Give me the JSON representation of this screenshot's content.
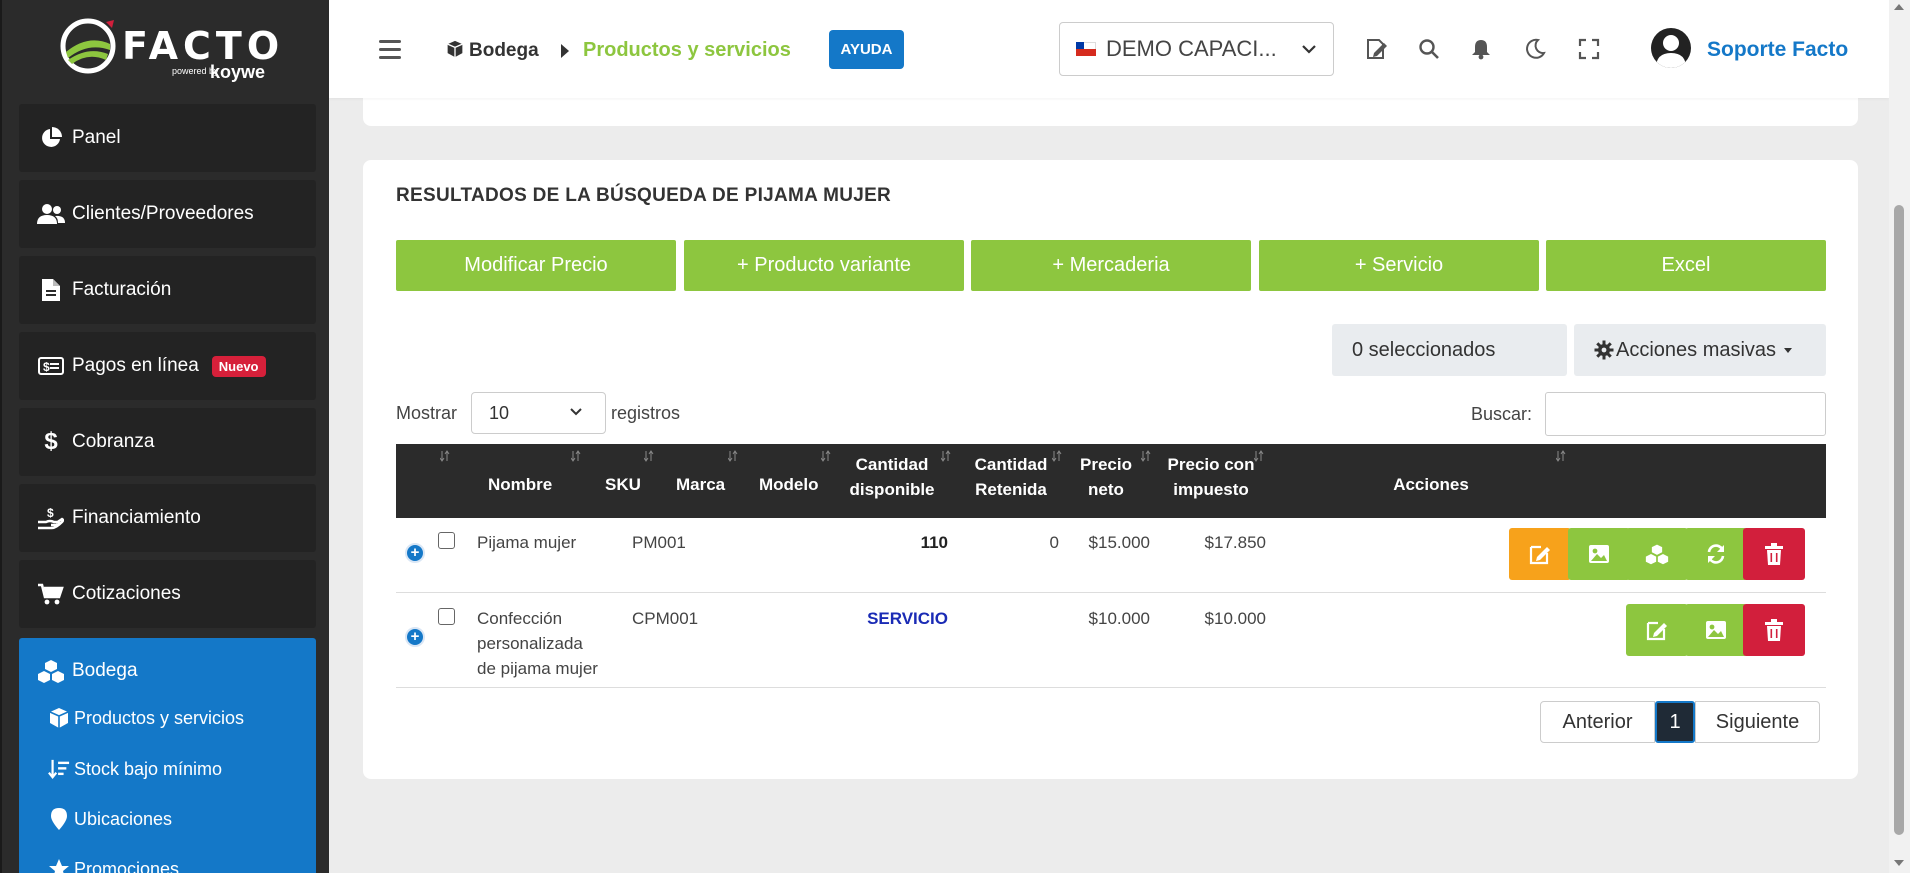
{
  "brand": {
    "logo_word": "FACTO",
    "logo_sub": "powered by",
    "logo_brand": "koywe",
    "green": "#8dc63f",
    "blue": "#1478c8",
    "red": "#d21f3c",
    "orange": "#f7a21b",
    "dark": "#2b2b2b"
  },
  "sidebar": {
    "items": [
      {
        "label": "Panel",
        "icon": "pie-chart-icon"
      },
      {
        "label": "Clientes/Proveedores",
        "icon": "users-icon"
      },
      {
        "label": "Facturación",
        "icon": "document-icon"
      },
      {
        "label": "Pagos en línea",
        "icon": "money-bill-icon",
        "badge": "Nuevo"
      },
      {
        "label": "Cobranza",
        "icon": "dollar-icon"
      },
      {
        "label": "Financiamiento",
        "icon": "hand-holding-dollar-icon"
      },
      {
        "label": "Cotizaciones",
        "icon": "cart-icon"
      },
      {
        "label": "Bodega",
        "icon": "cubes-icon"
      }
    ],
    "sub_items": [
      {
        "label": "Productos y servicios",
        "icon": "cube-icon"
      },
      {
        "label": "Stock bajo mínimo",
        "icon": "sort-amount-down-icon"
      },
      {
        "label": "Ubicaciones",
        "icon": "map-marker-icon"
      },
      {
        "label": "Promociones",
        "icon": "star-icon"
      }
    ]
  },
  "topbar": {
    "breadcrumb_root": "Bodega",
    "breadcrumb_current": "Productos y servicios",
    "help_label": "AYUDA",
    "company_name": "DEMO CAPACI...",
    "user_name": "Soporte Facto",
    "icons": [
      "edit-document-icon",
      "search-icon",
      "bell-icon",
      "moon-icon",
      "fullscreen-icon"
    ]
  },
  "results": {
    "title": "RESULTADOS DE LA BÚSQUEDA DE PIJAMA MUJER",
    "buttons": [
      "Modificar Precio",
      "+ Producto variante",
      "+ Mercaderia",
      "+ Servicio",
      "Excel"
    ],
    "selected_count": "0 seleccionados",
    "bulk_actions": "Acciones masivas",
    "show_label": "Mostrar",
    "show_value": "10",
    "show_suffix": "registros",
    "search_label": "Buscar:",
    "search_value": "",
    "columns": {
      "name": "Nombre",
      "sku": "SKU",
      "brand": "Marca",
      "model": "Modelo",
      "qty_a": "Cantidad",
      "qty_b": "disponible",
      "ret_a": "Cantidad",
      "ret_b": "Retenida",
      "net_a": "Precio",
      "net_b": "neto",
      "tax_a": "Precio con",
      "tax_b": "impuesto",
      "actions": "Acciones"
    },
    "rows": [
      {
        "name": "Pijama mujer",
        "sku": "PM001",
        "brand": "",
        "model": "",
        "qty": "110",
        "retained": "0",
        "net": "$15.000",
        "tax": "$17.850"
      },
      {
        "name_lines": [
          "Confección",
          "personalizada",
          "de pijama mujer"
        ],
        "sku": "CPM001",
        "brand": "",
        "model": "",
        "qty": "SERVICIO",
        "retained": "",
        "net": "$10.000",
        "tax": "$10.000"
      }
    ],
    "pagination": {
      "prev": "Anterior",
      "current": "1",
      "next": "Siguiente"
    }
  }
}
